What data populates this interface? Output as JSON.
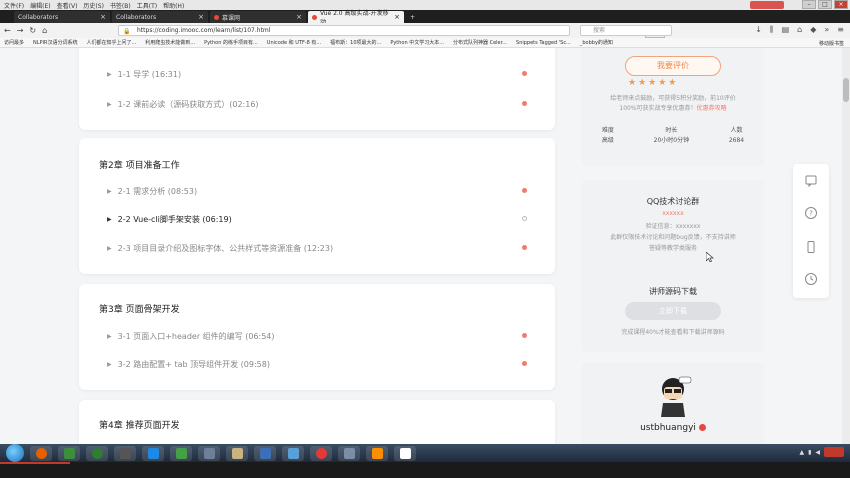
{
  "menubar": {
    "items": [
      "文件(F)",
      "编辑(E)",
      "查看(V)",
      "历史(S)",
      "书签(B)",
      "工具(T)",
      "帮助(H)"
    ]
  },
  "tabs": [
    {
      "label": "Collaborators"
    },
    {
      "label": "Collaborators"
    },
    {
      "label": "慕课网"
    },
    {
      "label": "Vue 2.0 高级实战-开发移动..."
    }
  ],
  "nav": {
    "url": "https://coding.imooc.com/learn/list/107.html",
    "zoom": "140%",
    "search_placeholder": "搜索"
  },
  "bookmarks": {
    "items": [
      "访问最多",
      "NLPIR汉语分词系统",
      "人们都在知乎上问了...",
      "利用爬虫技术能做到...",
      "Python 的练手项目有...",
      "Unicode 和 UTF-8 有...",
      "福布斯：10项最大的...",
      "Python 中文学习大本...",
      "分布式队列神器 Celer...",
      "Snippets Tagged 'Sc...",
      "_bobby的通知"
    ],
    "right": "移动版书签"
  },
  "chapters": [
    {
      "lessons": [
        {
          "label": "1-1 导学 (16:31)"
        },
        {
          "label": "1-2 课前必读（源码获取方式）(02:16)"
        }
      ]
    },
    {
      "title": "第2章 项目准备工作",
      "lessons": [
        {
          "label": "2-1 需求分析 (08:53)"
        },
        {
          "label": "2-2 Vue-cli脚手架安装 (06:19)"
        },
        {
          "label": "2-3 项目目录介绍及图标字体、公共样式等资源准备 (12:23)"
        }
      ]
    },
    {
      "title": "第3章 页面骨架开发",
      "lessons": [
        {
          "label": "3-1 页面入口+header 组件的编写 (06:54)"
        },
        {
          "label": "3-2 路由配置+ tab 顶导组件开发 (09:58)"
        }
      ]
    },
    {
      "title": "第4章 推荐页面开发"
    }
  ],
  "sidebar": {
    "eval_button": "我要评价",
    "stars": "★★★★★",
    "eval_note_1": "给老师来点鼓励，可获得5积分奖励，前10评价",
    "eval_note_2": "100%可获实战专享优惠券！",
    "eval_note_link": "优惠券攻略",
    "stats": [
      {
        "label": "难度",
        "value": "高级"
      },
      {
        "label": "时长",
        "value": "20小时0分钟"
      },
      {
        "label": "人数",
        "value": "2684"
      }
    ],
    "qq_title": "QQ技术讨论群",
    "qq_number": "xxxxxx",
    "qq_verify": "验证信息：xxxxxxx",
    "qq_note_1": "此群仅限技术讨论和问题bug反馈，不支持讲师",
    "qq_note_2": "答疑等教学类服务",
    "download_title": "讲师源码下载",
    "download_button": "立即下载",
    "download_note": "完成课程40%才能查看和下载讲师源码",
    "author_name": "ustbhuangyi"
  },
  "colors": {
    "accent": "#f08a4b",
    "dot": "#f07c6c",
    "page_bg": "#f3f5f7"
  }
}
